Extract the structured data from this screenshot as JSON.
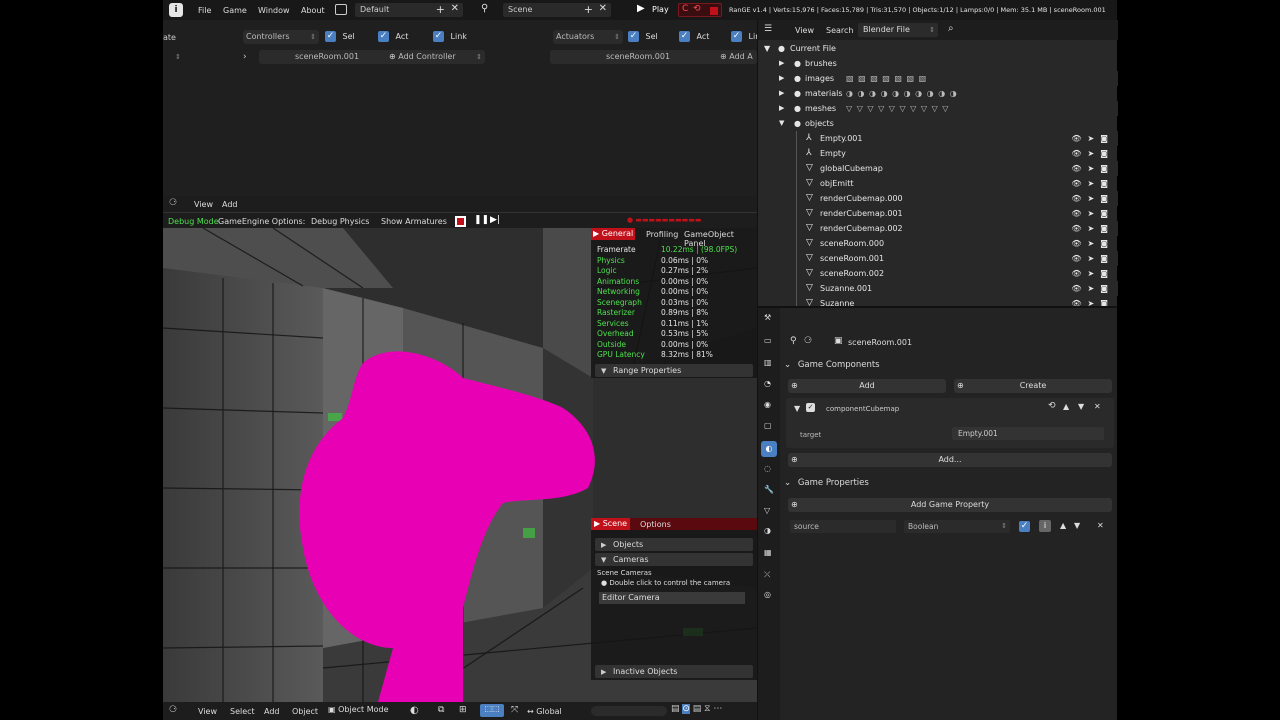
{
  "topbar": {
    "menus": [
      "File",
      "Game",
      "Window",
      "About"
    ],
    "workspace": "Default",
    "scene": "Scene",
    "play_label": "Play",
    "stats": "RanGE v1.4 | Verts:15,976 | Faces:15,789 | Tris:31,570 | Objects:1/12 | Lamps:0/0 | Mem: 35.1 MB | sceneRoom.001"
  },
  "logic": {
    "left_trunc": "ate",
    "controllers": "Controllers",
    "actuators": "Actuators",
    "sel": "Sel",
    "act": "Act",
    "link": "Link",
    "object_name": "sceneRoom.001",
    "add_controller": "Add Controller",
    "add_actuator_trunc": "Add A"
  },
  "viewport": {
    "header_view": "View",
    "header_add": "Add",
    "debug_mode": "Debug Mode",
    "engine_options": "GameEngine Options:",
    "debug_physics": "Debug Physics",
    "show_armatures": "Show Armatures",
    "bottom_menus": [
      "View",
      "Select",
      "Add",
      "Object"
    ],
    "mode": "Object Mode",
    "orientation": "Global"
  },
  "profiler": {
    "tabs": [
      "General",
      "Profiling",
      "GameObject Panel"
    ],
    "rows": [
      {
        "label": "Framerate",
        "value": "10.22ms | (98.0FPS)"
      },
      {
        "label": "Physics",
        "value": "0.06ms | 0%"
      },
      {
        "label": "Logic",
        "value": "0.27ms | 2%"
      },
      {
        "label": "Animations",
        "value": "0.00ms | 0%"
      },
      {
        "label": "Networking",
        "value": "0.00ms | 0%"
      },
      {
        "label": "Scenegraph",
        "value": "0.03ms | 0%"
      },
      {
        "label": "Rasterizer",
        "value": "0.89ms | 8%"
      },
      {
        "label": "Services",
        "value": "0.11ms | 1%"
      },
      {
        "label": "Overhead",
        "value": "0.53ms | 5%"
      },
      {
        "label": "Outside",
        "value": "0.00ms | 0%"
      },
      {
        "label": "GPU Latency",
        "value": "8.32ms | 81%"
      }
    ],
    "range_properties": "Range Properties"
  },
  "scene_panel": {
    "tabs": [
      "Scene",
      "Options"
    ],
    "objects": "Objects",
    "cameras": "Cameras",
    "scene_cameras": "Scene Cameras",
    "hint": "Double click to control the camera",
    "editor_camera": "Editor Camera",
    "inactive_objects": "Inactive Objects"
  },
  "outliner": {
    "header_view": "View",
    "header_search": "Search",
    "display_mode": "Blender File",
    "root": "Current File",
    "groups": [
      "brushes",
      "images",
      "materials",
      "meshes",
      "objects"
    ],
    "objects": [
      "Empty.001",
      "Empty",
      "globalCubemap",
      "objEmitt",
      "renderCubemap.000",
      "renderCubemap.001",
      "renderCubemap.002",
      "sceneRoom.000",
      "sceneRoom.001",
      "sceneRoom.002",
      "Suzanne.001",
      "Suzanne"
    ]
  },
  "properties": {
    "object_name": "sceneRoom.001",
    "game_components": "Game Components",
    "add": "Add",
    "create": "Create",
    "component_name": "componentCubemap",
    "target_label": "target",
    "target_value": "Empty.001",
    "add_more": "Add...",
    "game_properties": "Game Properties",
    "add_game_property": "Add Game Property",
    "prop_name": "source",
    "prop_type": "Boolean"
  },
  "colors": {
    "accent_blue": "#4a7fc1",
    "magenta": "#e800b4",
    "green": "#4ee04e",
    "red": "#c0101a"
  }
}
